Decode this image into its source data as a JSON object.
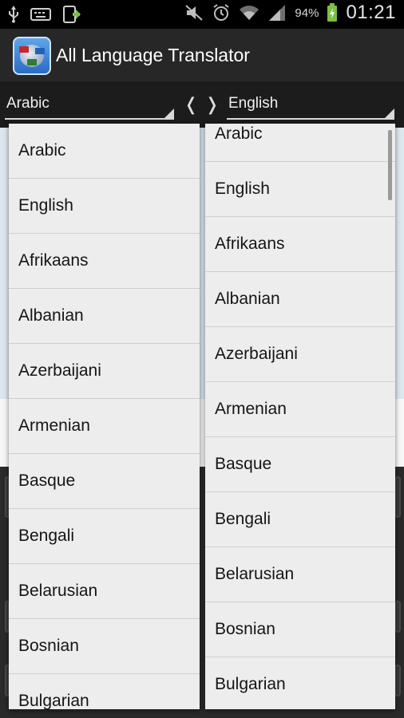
{
  "status_bar": {
    "icons_left": [
      "usb-icon",
      "keyboard-icon",
      "download-icon"
    ],
    "icons_right": [
      "mute-icon",
      "alarm-icon",
      "wifi-icon",
      "signal-icon"
    ],
    "battery": "94%",
    "time": "01:21"
  },
  "app": {
    "title": "All Language Translator",
    "icon": "translator-globe-icon"
  },
  "spinners": {
    "source": "Arabic",
    "target": "English",
    "swap_left": "❬",
    "swap_right": "❭"
  },
  "source_list": {
    "items": [
      "Arabic",
      "English",
      "Afrikaans",
      "Albanian",
      "Azerbaijani",
      "Armenian",
      "Basque",
      "Bengali",
      "Belarusian",
      "Bosnian",
      "Bulgarian"
    ]
  },
  "target_list": {
    "items": [
      "Arabic",
      "English",
      "Afrikaans",
      "Albanian",
      "Azerbaijani",
      "Armenian",
      "Basque",
      "Bengali",
      "Belarusian",
      "Bosnian",
      "Bulgarian"
    ]
  },
  "colors": {
    "actionbar": "#272727",
    "dropdown_bg": "#ededed",
    "divider": "#cfcfcf"
  }
}
